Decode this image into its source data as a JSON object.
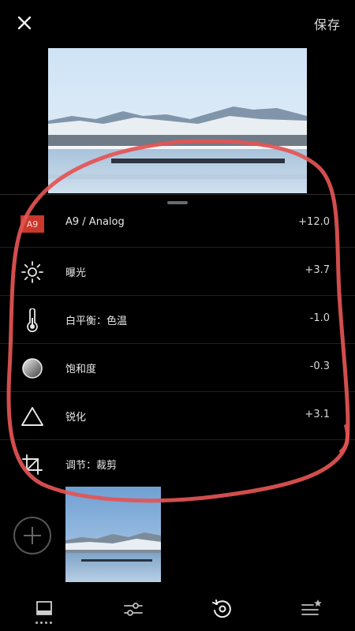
{
  "header": {
    "close_icon": "close-icon",
    "save_label": "保存"
  },
  "edits": [
    {
      "icon": "preset-badge",
      "badge": "A9",
      "label": "A9 / Analog",
      "value": "+12.0"
    },
    {
      "icon": "exposure-sun-icon",
      "label": "曝光",
      "value": "+3.7"
    },
    {
      "icon": "thermometer-icon",
      "label": "白平衡：色温",
      "value": "-1.0"
    },
    {
      "icon": "saturation-circle-icon",
      "label": "饱和度",
      "value": "-0.3"
    },
    {
      "icon": "sharpen-triangle-icon",
      "label": "锐化",
      "value": "+3.1"
    },
    {
      "icon": "crop-icon",
      "label": "调节：裁剪",
      "value": ""
    }
  ],
  "toolbar": {
    "tabs": [
      "filmstrip-icon",
      "adjust-sliders-icon",
      "history-revert-icon",
      "favorites-list-icon"
    ]
  },
  "colors": {
    "background": "#000000",
    "preset_badge": "#c9382b",
    "annotation_stroke": "#e45454"
  }
}
